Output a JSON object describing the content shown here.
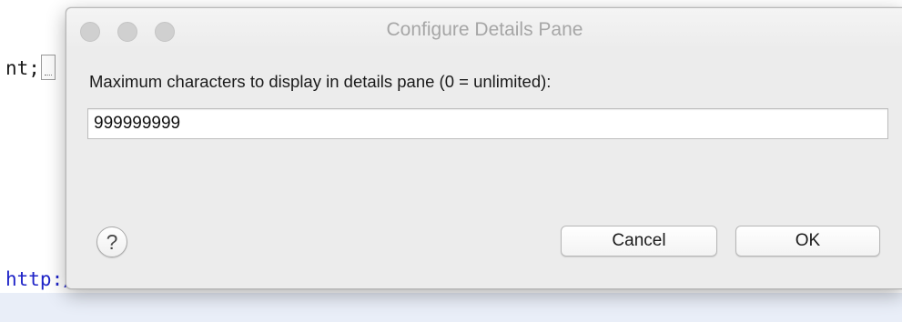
{
  "editor": {
    "line_top": "nt;",
    "line_url": "http://www.amazon.fr/",
    "line_url_suffix": "\");"
  },
  "dialog": {
    "title": "Configure Details Pane",
    "prompt": "Maximum characters to display in details pane (0 = unlimited):",
    "value": "999999999",
    "help_glyph": "?",
    "cancel_label": "Cancel",
    "ok_label": "OK"
  },
  "icons": {
    "help": "question-mark-circle-icon",
    "window_controls": [
      "close-traffic-light-icon",
      "minimize-traffic-light-icon",
      "zoom-traffic-light-icon"
    ]
  },
  "colors": {
    "dialog_bg": "#ececec",
    "title_text": "#a6a6a6",
    "url_text": "#1f24c8",
    "highlight_band": "#e9eef8"
  }
}
